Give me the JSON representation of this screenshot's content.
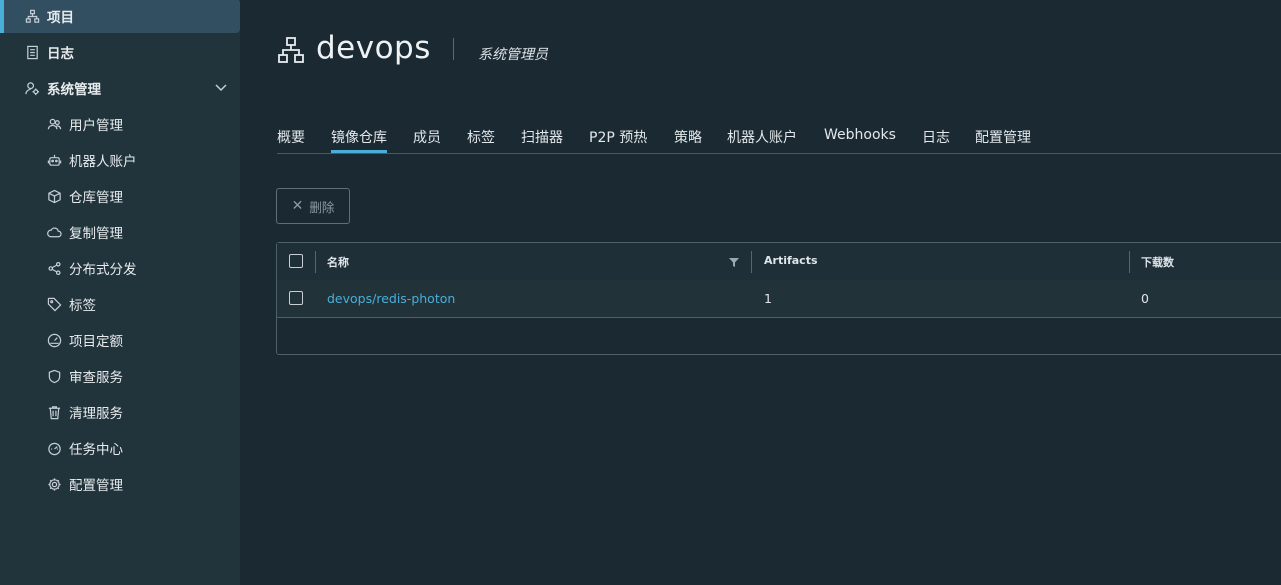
{
  "sidebar": {
    "items": [
      {
        "label": "项目",
        "icon": "project-icon"
      },
      {
        "label": "日志",
        "icon": "log-icon"
      },
      {
        "label": "系统管理",
        "icon": "system-admin-icon"
      },
      {
        "label": "用户管理",
        "icon": "users-icon"
      },
      {
        "label": "机器人账户",
        "icon": "robot-icon"
      },
      {
        "label": "仓库管理",
        "icon": "cube-icon"
      },
      {
        "label": "复制管理",
        "icon": "cloud-icon"
      },
      {
        "label": "分布式分发",
        "icon": "share-icon"
      },
      {
        "label": "标签",
        "icon": "tag-icon"
      },
      {
        "label": "项目定额",
        "icon": "dashboard-icon"
      },
      {
        "label": "审查服务",
        "icon": "shield-icon"
      },
      {
        "label": "清理服务",
        "icon": "trash-icon"
      },
      {
        "label": "任务中心",
        "icon": "gauge-icon"
      },
      {
        "label": "配置管理",
        "icon": "gear-icon"
      }
    ]
  },
  "header": {
    "title": "devops",
    "role": "系统管理员"
  },
  "tabs": [
    {
      "label": "概要"
    },
    {
      "label": "镜像仓库"
    },
    {
      "label": "成员"
    },
    {
      "label": "标签"
    },
    {
      "label": "扫描器"
    },
    {
      "label": "P2P 预热"
    },
    {
      "label": "策略"
    },
    {
      "label": "机器人账户"
    },
    {
      "label": "Webhooks"
    },
    {
      "label": "日志"
    },
    {
      "label": "配置管理"
    }
  ],
  "toolbar": {
    "delete_label": "删除"
  },
  "table": {
    "columns": [
      "名称",
      "Artifacts",
      "下载数"
    ],
    "rows": [
      {
        "name": "devops/redis-photon",
        "artifacts": "1",
        "pulls": "0"
      }
    ]
  },
  "colors": {
    "accent": "#49afd9",
    "background": "#1b2a32",
    "sidebar": "#21333b"
  }
}
